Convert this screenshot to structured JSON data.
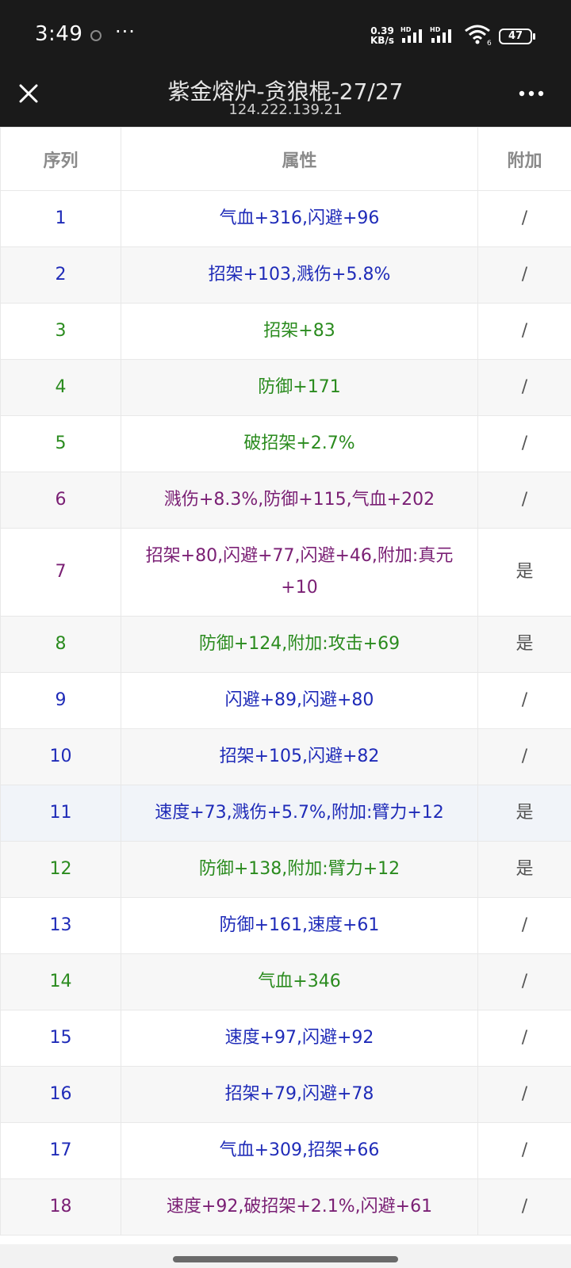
{
  "status_bar": {
    "time": "3:49",
    "dots": "···",
    "speed_value": "0.39",
    "speed_unit": "KB/s",
    "hd1": "HD",
    "hd2": "HD",
    "wifi_badge": "6",
    "battery": "47",
    "icons": [
      "app-notification-icon",
      "signal-icon",
      "signal-icon",
      "wifi-icon",
      "battery-icon"
    ]
  },
  "header": {
    "title": "紫金熔炉-贪狼棍-27/27",
    "subtitle": "124.222.139.21",
    "close_icon": "close-icon",
    "more_icon": "more-icon"
  },
  "table": {
    "columns": [
      "序列",
      "属性",
      "附加"
    ],
    "rows": [
      {
        "index": "1",
        "attr": "气血+316,闪避+96",
        "addon": "/",
        "color": "#1f2bb8"
      },
      {
        "index": "2",
        "attr": "招架+103,溅伤+5.8%",
        "addon": "/",
        "color": "#1f2bb8"
      },
      {
        "index": "3",
        "attr": "招架+83",
        "addon": "/",
        "color": "#2a8b1e"
      },
      {
        "index": "4",
        "attr": "防御+171",
        "addon": "/",
        "color": "#2a8b1e"
      },
      {
        "index": "5",
        "attr": "破招架+2.7%",
        "addon": "/",
        "color": "#2a8b1e"
      },
      {
        "index": "6",
        "attr": "溅伤+8.3%,防御+115,气血+202",
        "addon": "/",
        "color": "#7a1f74"
      },
      {
        "index": "7",
        "attr": "招架+80,闪避+77,闪避+46,附加:真元+10",
        "addon": "是",
        "color": "#7a1f74"
      },
      {
        "index": "8",
        "attr": "防御+124,附加:攻击+69",
        "addon": "是",
        "color": "#2a8b1e"
      },
      {
        "index": "9",
        "attr": "闪避+89,闪避+80",
        "addon": "/",
        "color": "#1f2bb8"
      },
      {
        "index": "10",
        "attr": "招架+105,闪避+82",
        "addon": "/",
        "color": "#1f2bb8"
      },
      {
        "index": "11",
        "attr": "速度+73,溅伤+5.7%,附加:臂力+12",
        "addon": "是",
        "color": "#1f2bb8"
      },
      {
        "index": "12",
        "attr": "防御+138,附加:臂力+12",
        "addon": "是",
        "color": "#2a8b1e"
      },
      {
        "index": "13",
        "attr": "防御+161,速度+61",
        "addon": "/",
        "color": "#1f2bb8"
      },
      {
        "index": "14",
        "attr": "气血+346",
        "addon": "/",
        "color": "#2a8b1e"
      },
      {
        "index": "15",
        "attr": "速度+97,闪避+92",
        "addon": "/",
        "color": "#1f2bb8"
      },
      {
        "index": "16",
        "attr": "招架+79,闪避+78",
        "addon": "/",
        "color": "#1f2bb8"
      },
      {
        "index": "17",
        "attr": "气血+309,招架+66",
        "addon": "/",
        "color": "#1f2bb8"
      },
      {
        "index": "18",
        "attr": "速度+92,破招架+2.1%,闪避+61",
        "addon": "/",
        "color": "#7a1f74"
      }
    ]
  }
}
